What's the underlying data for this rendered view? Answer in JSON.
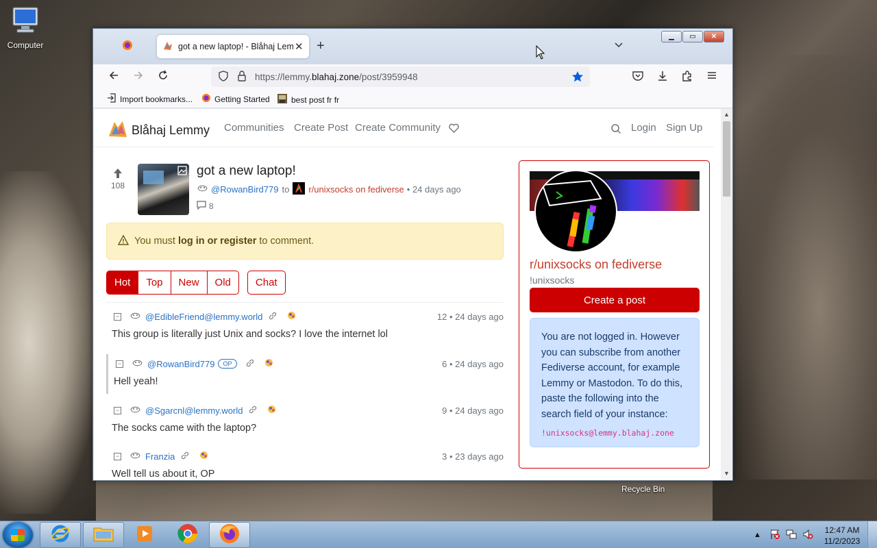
{
  "desktop": {
    "computer_label": "Computer",
    "recycle_label": "Recycle Bin"
  },
  "browser": {
    "tab_title": "got a new laptop! - Blåhaj Lemm",
    "url_prefix": "https://lemmy.",
    "url_host": "blahaj.zone",
    "url_path": "/post/3959948",
    "bookmarks": [
      "Import bookmarks...",
      "Getting Started",
      "best post fr fr"
    ]
  },
  "site": {
    "brand": "Blåhaj Lemmy",
    "nav": [
      "Communities",
      "Create Post",
      "Create Community"
    ],
    "login": "Login",
    "signup": "Sign Up"
  },
  "post": {
    "score": "108",
    "title": "got a new laptop!",
    "author": "@RowanBird779",
    "to": "to",
    "community": "r/unixsocks on fediverse",
    "age": "• 24 days ago",
    "comment_count": "8"
  },
  "alert": {
    "prefix": "You must ",
    "link": "log in or register",
    "suffix": " to comment."
  },
  "sort": {
    "options": [
      "Hot",
      "Top",
      "New",
      "Old"
    ],
    "active": "Hot",
    "chat": "Chat"
  },
  "comments": [
    {
      "user": "@EdibleFriend@lemmy.world",
      "meta": "12 • 24 days ago",
      "text": "This group is literally just Unix and socks? I love the internet lol",
      "op": ""
    },
    {
      "user": "@RowanBird779",
      "meta": "6 • 24 days ago",
      "text": "Hell yeah!",
      "op": "OP"
    },
    {
      "user": "@Sgarcnl@lemmy.world",
      "meta": "9 • 24 days ago",
      "text": "The socks came with the laptop?",
      "op": ""
    },
    {
      "user": "Franzia",
      "meta": "3 • 23 days ago",
      "text": "Well tell us about it, OP",
      "op": ""
    }
  ],
  "sidebar": {
    "name": "r/unixsocks on fediverse",
    "handle": "!unixsocks",
    "create_post": "Create a post",
    "info": "You are not logged in. However you can subscribe from another Fediverse account, for example Lemmy or Mastodon. To do this, paste the following into the search field of your instance:",
    "code": "!unixsocks@lemmy.blahaj.zone"
  },
  "taskbar": {
    "time": "12:47 AM",
    "date": "11/2/2023"
  },
  "colors": {
    "accent": "#cc0000",
    "link": "#2a72c5",
    "info_bg": "#cfe2ff",
    "alert_bg": "#fdf1c8"
  }
}
